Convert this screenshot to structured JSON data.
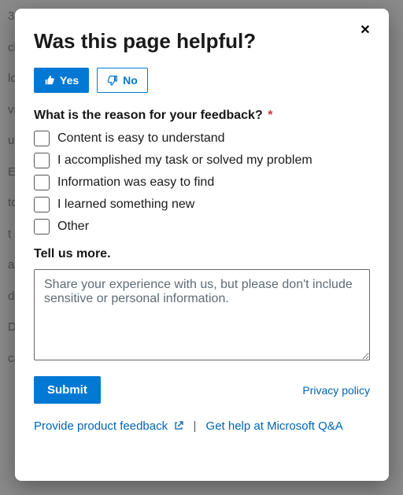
{
  "modal": {
    "title": "Was this page helpful?",
    "close_label": "✕",
    "yes_label": "Yes",
    "no_label": "No",
    "question": "What is the reason for your feedback?",
    "required_mark": "*",
    "options": [
      "Content is easy to understand",
      "I accomplished my task or solved my problem",
      "Information was easy to find",
      "I learned something new",
      "Other"
    ],
    "tell_us_label": "Tell us more.",
    "textarea_placeholder": "Share your experience with us, but please don't include sensitive or personal information.",
    "submit_label": "Submit",
    "privacy_label": "Privacy policy",
    "product_feedback_label": "Provide product feedback",
    "qa_label": "Get help at Microsoft Q&A",
    "separator": "|"
  }
}
